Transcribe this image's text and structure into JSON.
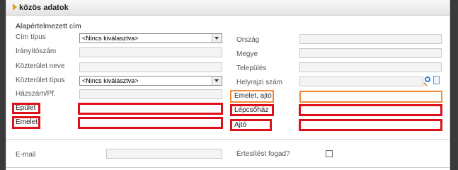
{
  "panel": {
    "title": "közös adatok"
  },
  "section": {
    "label": "Alapértelmezett cím"
  },
  "left_fields": {
    "cim_tipus": {
      "label": "Cím típus",
      "value": "<Nincs kiválasztva>"
    },
    "iranyitoszam": {
      "label": "Irányítószám",
      "value": ""
    },
    "kozterulet_neve": {
      "label": "Közterület neve",
      "value": ""
    },
    "kozterulet_tipus": {
      "label": "Közterület típus",
      "value": "<Nincs kiválasztva>"
    },
    "hazszam": {
      "label": "Házszám/Pf.",
      "value": ""
    },
    "epulet": {
      "label": "Épület",
      "value": ""
    },
    "emelet": {
      "label": "Emelet",
      "value": ""
    }
  },
  "right_fields": {
    "orszag": {
      "label": "Ország",
      "value": ""
    },
    "megye": {
      "label": "Megye",
      "value": ""
    },
    "telepules": {
      "label": "Település",
      "value": ""
    },
    "helyrajzi_szam": {
      "label": "Helyrajzi szám",
      "value": ""
    },
    "emelet_ajto": {
      "label": "Emelet, ajtó",
      "value": ""
    },
    "lepcsohaz": {
      "label": "Lépcsőház",
      "value": ""
    },
    "ajto": {
      "label": "Ajtó",
      "value": ""
    }
  },
  "bottom": {
    "email_label": "E-mail",
    "email_value": "",
    "notify_label": "Értesítést fogad?",
    "notify_checked": false
  },
  "icons": {
    "search": "magnifier-icon",
    "document": "document-icon"
  },
  "colors": {
    "highlight_red": "#e0101a",
    "highlight_orange": "#f2883a",
    "accent": "#e8a020"
  }
}
